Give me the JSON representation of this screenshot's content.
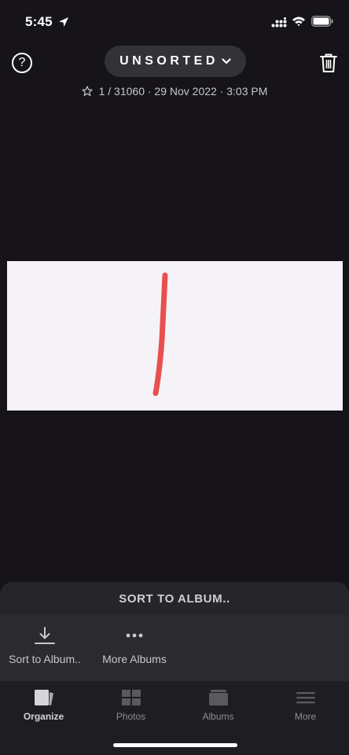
{
  "status_bar": {
    "time": "5:45",
    "icons": [
      "location-arrow-icon",
      "signal-icon",
      "wifi-icon",
      "battery-icon"
    ]
  },
  "header": {
    "help_icon": "question-circle-icon",
    "help_glyph": "?",
    "album_title": "UNSORTED",
    "album_chevron": "chevron-down-icon",
    "trash_icon": "trash-icon"
  },
  "photo_meta": {
    "star_icon": "star-outline-icon",
    "text": "1 / 31060 · 29 Nov 2022 · 3:03 PM"
  },
  "photo": {
    "background_color": "#f5f3f7",
    "stroke_color": "#e8504f"
  },
  "sort_sheet": {
    "title": "SORT TO ALBUM..",
    "actions": [
      {
        "label": "Sort to Album..",
        "icon": "download-icon"
      },
      {
        "label": "More Albums",
        "icon": "more-dots-icon"
      }
    ]
  },
  "tab_bar": {
    "tabs": [
      {
        "label": "Organize",
        "icon": "organize-icon",
        "active": true
      },
      {
        "label": "Photos",
        "icon": "photos-grid-icon",
        "active": false
      },
      {
        "label": "Albums",
        "icon": "albums-icon",
        "active": false
      },
      {
        "label": "More",
        "icon": "menu-icon",
        "active": false
      }
    ]
  },
  "colors": {
    "background": "#161418",
    "pill": "#333236",
    "sheet": "#26252a",
    "tab_bar": "#1e1d22"
  }
}
